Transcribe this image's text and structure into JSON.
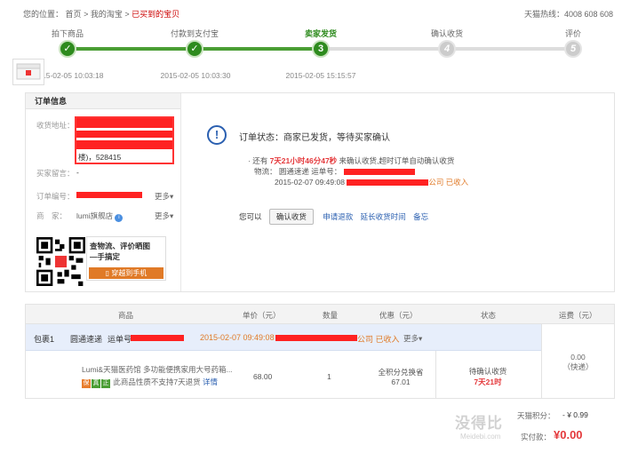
{
  "breadcrumb": {
    "label": "您的位置：",
    "home": "首页",
    "my": "我的淘宝",
    "current": "已买到的宝贝",
    "sep": ">"
  },
  "hotline": "天猫热线：4008 608 608",
  "steps": [
    {
      "label": "拍下商品",
      "time": "2015-02-05 10:03:18",
      "num": ""
    },
    {
      "label": "付款到支付宝",
      "time": "2015-02-05 10:03:30",
      "num": ""
    },
    {
      "label": "卖家发货",
      "time": "2015-02-05 15:15:57",
      "num": "3"
    },
    {
      "label": "确认收货",
      "time": "",
      "num": "4"
    },
    {
      "label": "评价",
      "time": "",
      "num": "5"
    }
  ],
  "order_info": {
    "title": "订单信息",
    "addr_label": "收货地址：",
    "addr_tail": "楼)，528415",
    "message_label": "买家留言：",
    "message_value": "-",
    "order_no_label": "订单编号：",
    "seller_label": "商　家：",
    "seller_name": "lumi旗舰店",
    "more": "更多"
  },
  "promo": {
    "line1": "查物流、评价晒图",
    "line2": "—手搞定",
    "button": "穿越到手机"
  },
  "status": {
    "icon": "!",
    "title": "订单状态：商家已发货，等待买家确认",
    "remain_prefix": "· 还有",
    "remain_time": "7天21小时46分47秒",
    "remain_suffix": "来确认收货,超时订单自动确认收货",
    "logistics_label": "物流：",
    "carrier": "圆通速递",
    "waybill_label": "运单号：",
    "log_time": "2015-02-07 09:49:08",
    "log_tail": "公司 已收入",
    "you_can": "您可以",
    "confirm_btn": "确认收货",
    "refund_link": "申请退款",
    "extend_link": "延长收货时间",
    "note_link": "备忘"
  },
  "table": {
    "headers": [
      "商品",
      "单价（元）",
      "数量",
      "优惠（元）",
      "状态",
      "运费（元）"
    ],
    "package": {
      "label": "包裹1",
      "carrier": "圆通速递",
      "waybill_label": "运单号",
      "time": "2015-02-07 09:49:08",
      "tail": "公司 已收入",
      "more": "更多"
    },
    "item": {
      "name": "Lumi&天猫医药馆 多功能便携家用大号药箱...",
      "tags": [
        "保",
        "真",
        "正"
      ],
      "return_note": "此商品性质不支持7天退货",
      "detail_link": "详情",
      "price": "68.00",
      "qty": "1",
      "discount_label": "全积分兑换省",
      "discount_value": "67.01",
      "status": "待确认收货",
      "status_time": "7天21时",
      "shipping": "0.00",
      "shipping_type": "（快递）"
    }
  },
  "totals": {
    "points_label": "天猫积分：",
    "points_value": "- ¥ 0.99",
    "paid_label": "实付款：",
    "paid_value": "¥0.00"
  },
  "watermark": {
    "main": "没得比",
    "sub": "Meidebi.com"
  },
  "colors": {
    "green": "#2e8b1e",
    "red": "#e4393c",
    "blue": "#2a5fb0",
    "orange": "#e07a27"
  }
}
